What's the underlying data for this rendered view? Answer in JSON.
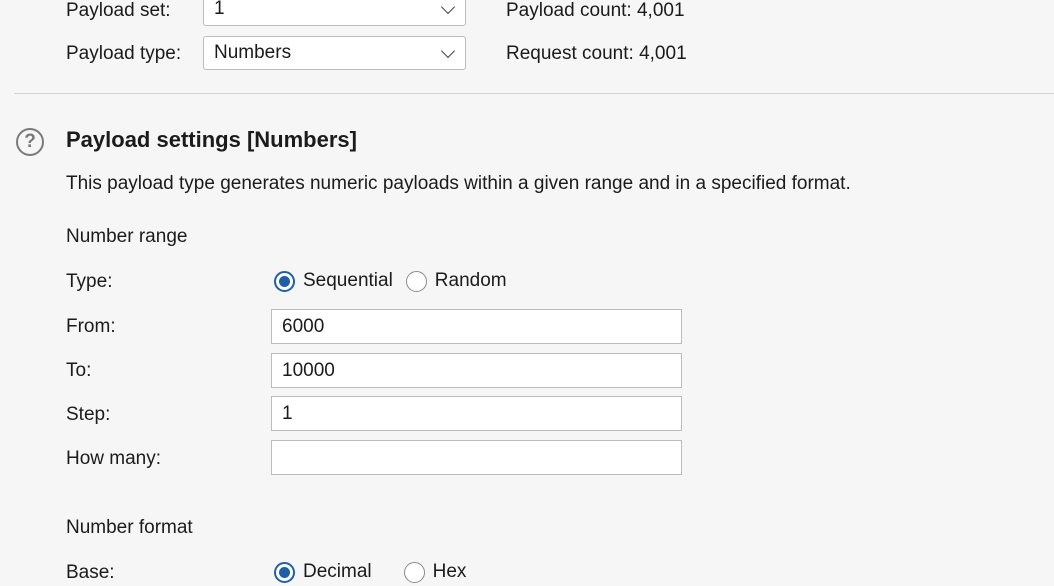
{
  "payload": {
    "set_label": "Payload set:",
    "set_value": "1",
    "type_label": "Payload type:",
    "type_value": "Numbers",
    "payload_count": "Payload count: 4,001",
    "request_count": "Request count: 4,001"
  },
  "settings": {
    "help_glyph": "?",
    "title": "Payload settings [Numbers]",
    "description": "This payload type generates numeric payloads within a given range and in a specified format.",
    "number_range": {
      "heading": "Number range",
      "type_label": "Type:",
      "type_options": [
        "Sequential",
        "Random"
      ],
      "type_selected": "Sequential",
      "from_label": "From:",
      "from_value": "6000",
      "to_label": "To:",
      "to_value": "10000",
      "step_label": "Step:",
      "step_value": "1",
      "how_many_label": "How many:",
      "how_many_value": ""
    },
    "number_format": {
      "heading": "Number format",
      "base_label": "Base:",
      "base_options": [
        "Decimal",
        "Hex"
      ],
      "base_selected": "Decimal"
    }
  },
  "colors": {
    "accent": "#1f5fa8",
    "background": "#f6f6f7",
    "border": "#bcbcbc"
  }
}
